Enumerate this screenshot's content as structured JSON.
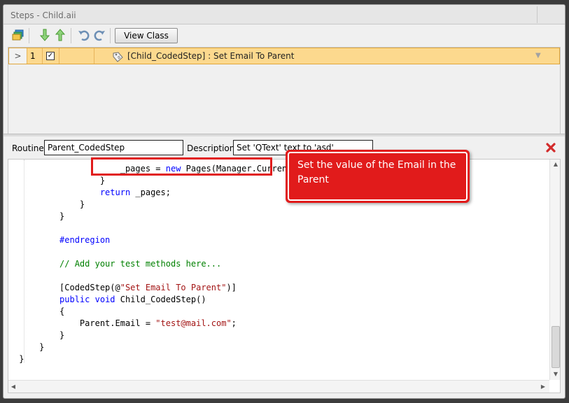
{
  "window": {
    "title": "Steps - Child.aii"
  },
  "toolbar": {
    "view_class_label": "View Class"
  },
  "steps": [
    {
      "row_indicator": ">",
      "number": "1",
      "checked": "✓",
      "text": "[Child_CodedStep] : Set Email To Parent"
    }
  ],
  "routine": {
    "routine_label": "Routine",
    "routine_value": "Parent_CodedStep",
    "description_label": "Description",
    "description_value": "Set 'QText' text to 'asd'"
  },
  "code_lines": [
    {
      "indent": "                     ",
      "parts": [
        {
          "t": "_pages = "
        },
        {
          "t": "new",
          "c": "kw"
        },
        {
          "t": " Pages(Manager.Current);"
        }
      ]
    },
    {
      "indent": "                 ",
      "parts": [
        {
          "t": "}"
        }
      ]
    },
    {
      "indent": "                 ",
      "parts": [
        {
          "t": "return",
          "c": "kw"
        },
        {
          "t": " _pages;"
        }
      ]
    },
    {
      "indent": "             ",
      "parts": [
        {
          "t": "}"
        }
      ]
    },
    {
      "indent": "         ",
      "parts": [
        {
          "t": "}"
        }
      ]
    },
    {
      "indent": "",
      "parts": []
    },
    {
      "indent": "         ",
      "parts": [
        {
          "t": "#endregion",
          "c": "pp"
        }
      ]
    },
    {
      "indent": "",
      "parts": []
    },
    {
      "indent": "         ",
      "parts": [
        {
          "t": "// Add your test methods here...",
          "c": "cm"
        }
      ]
    },
    {
      "indent": "",
      "parts": []
    },
    {
      "indent": "         ",
      "parts": [
        {
          "t": "[CodedStep(@"
        },
        {
          "t": "\"Set Email To Parent\"",
          "c": "st"
        },
        {
          "t": ")]"
        }
      ]
    },
    {
      "indent": "         ",
      "parts": [
        {
          "t": "public",
          "c": "kw"
        },
        {
          "t": " "
        },
        {
          "t": "void",
          "c": "kw"
        },
        {
          "t": " Child_CodedStep()"
        }
      ]
    },
    {
      "indent": "         ",
      "parts": [
        {
          "t": "{"
        }
      ]
    },
    {
      "indent": "             ",
      "parts": [
        {
          "t": "Parent.Email = "
        },
        {
          "t": "\"test@mail.com\"",
          "c": "st"
        },
        {
          "t": ";"
        }
      ]
    },
    {
      "indent": "         ",
      "parts": [
        {
          "t": "}"
        }
      ]
    },
    {
      "indent": "     ",
      "parts": [
        {
          "t": "}"
        }
      ]
    },
    {
      "indent": " ",
      "parts": [
        {
          "t": "}"
        }
      ]
    }
  ],
  "callout": {
    "text": "Set the value of the Email in the Parent"
  },
  "colors": {
    "selected_row": "#fcd98e",
    "annotation_red": "#e11b1b",
    "keyword_blue": "#0000ff",
    "comment_green": "#008000",
    "string_red": "#a31515"
  },
  "icons": {
    "toolbar": [
      "layers-icon",
      "move-down-icon",
      "move-up-icon",
      "undo-icon",
      "redo-icon"
    ],
    "step": "coded-step-icon",
    "delete": "delete-x-icon"
  }
}
